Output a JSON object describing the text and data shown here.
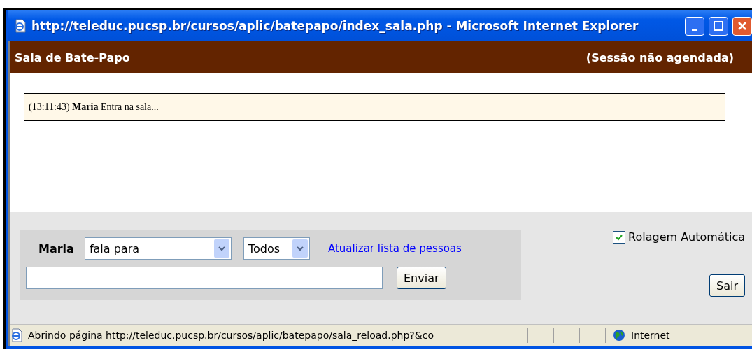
{
  "window": {
    "title": "http://teleduc.pucsp.br/cursos/aplic/batepapo/index_sala.php - Microsoft Internet Explorer"
  },
  "header": {
    "title": "Sala de Bate-Papo",
    "session": "(Sessão não agendada)"
  },
  "messages": [
    "(13:11:43) **Maria** Entra na sala..."
  ],
  "form": {
    "user": "Maria",
    "verb": "fala para",
    "recipient": "Todos",
    "refresh_link": "Atualizar lista de pessoas",
    "send": "Enviar"
  },
  "auto_scroll": {
    "label": "Rolagem Automática",
    "checked": true
  },
  "exit": "Sair",
  "status_bar": {
    "text": "Abrindo página http://teleduc.pucsp.br/cursos/aplic/batepapo/sala_reload.php?&co",
    "zone": "Internet"
  }
}
